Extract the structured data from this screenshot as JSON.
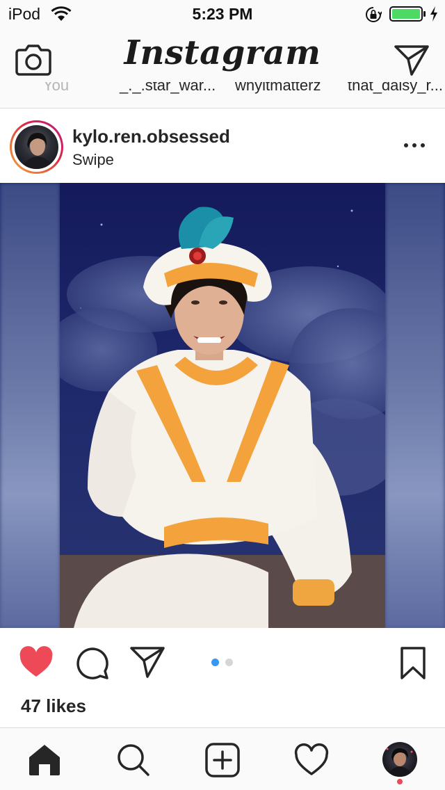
{
  "status_bar": {
    "device": "iPod",
    "time": "5:23 PM",
    "battery_color": "#4cd964"
  },
  "header": {
    "logo": "Instagram",
    "camera_icon": "camera-icon",
    "direct_icon": "paper-plane-icon"
  },
  "stories": [
    "You",
    "_._.star_war...",
    "whyitmatterz",
    "that_daisy_r..."
  ],
  "post": {
    "username": "kylo.ren.obsessed",
    "location": "Swipe",
    "more_icon": "more-dots-icon",
    "likes": "47 likes",
    "liked": true,
    "like_color": "#ed4956",
    "carousel_total": 2,
    "carousel_active": 1,
    "carousel_active_color": "#3897f0",
    "carousel_inactive_color": "#d6d6d6"
  },
  "tab_bar": {
    "items": [
      "home-icon",
      "search-icon",
      "add-icon",
      "heart-icon",
      "profile-avatar"
    ],
    "notification_dot_color": "#ed4956"
  }
}
